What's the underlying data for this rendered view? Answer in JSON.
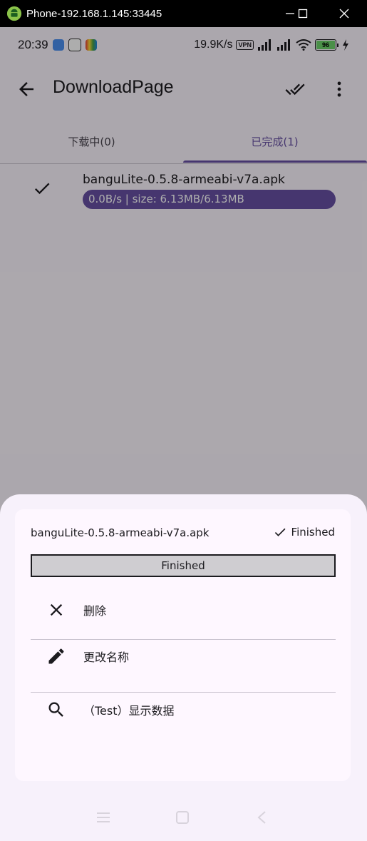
{
  "window": {
    "title": "Phone-192.168.1.145:33445"
  },
  "status_bar": {
    "time": "20:39",
    "net_speed": "19.9K/s",
    "vpn_label": "VPN",
    "battery_level": "96"
  },
  "app_bar": {
    "title": "DownloadPage"
  },
  "tabs": [
    {
      "label": "下载中(0)",
      "active": false
    },
    {
      "label": "已完成(1)",
      "active": true
    }
  ],
  "download_item": {
    "filename": "banguLite-0.5.8-armeabi-v7a.apk",
    "progress_text": "0.0B/s  |  size: 6.13MB/6.13MB"
  },
  "sheet": {
    "filename": "banguLite-0.5.8-armeabi-v7a.apk",
    "status": "Finished",
    "progress_label": "Finished",
    "progress": 1.0,
    "menu": [
      {
        "label": "删除",
        "icon": "close-icon"
      },
      {
        "label": "更改名称",
        "icon": "edit-icon"
      },
      {
        "label": "（Test）显示数据",
        "icon": "search-icon"
      }
    ]
  },
  "colors": {
    "primary": "#6750a4",
    "surface": "#fef7ff",
    "scrim": "rgba(0,0,0,0.32)"
  }
}
